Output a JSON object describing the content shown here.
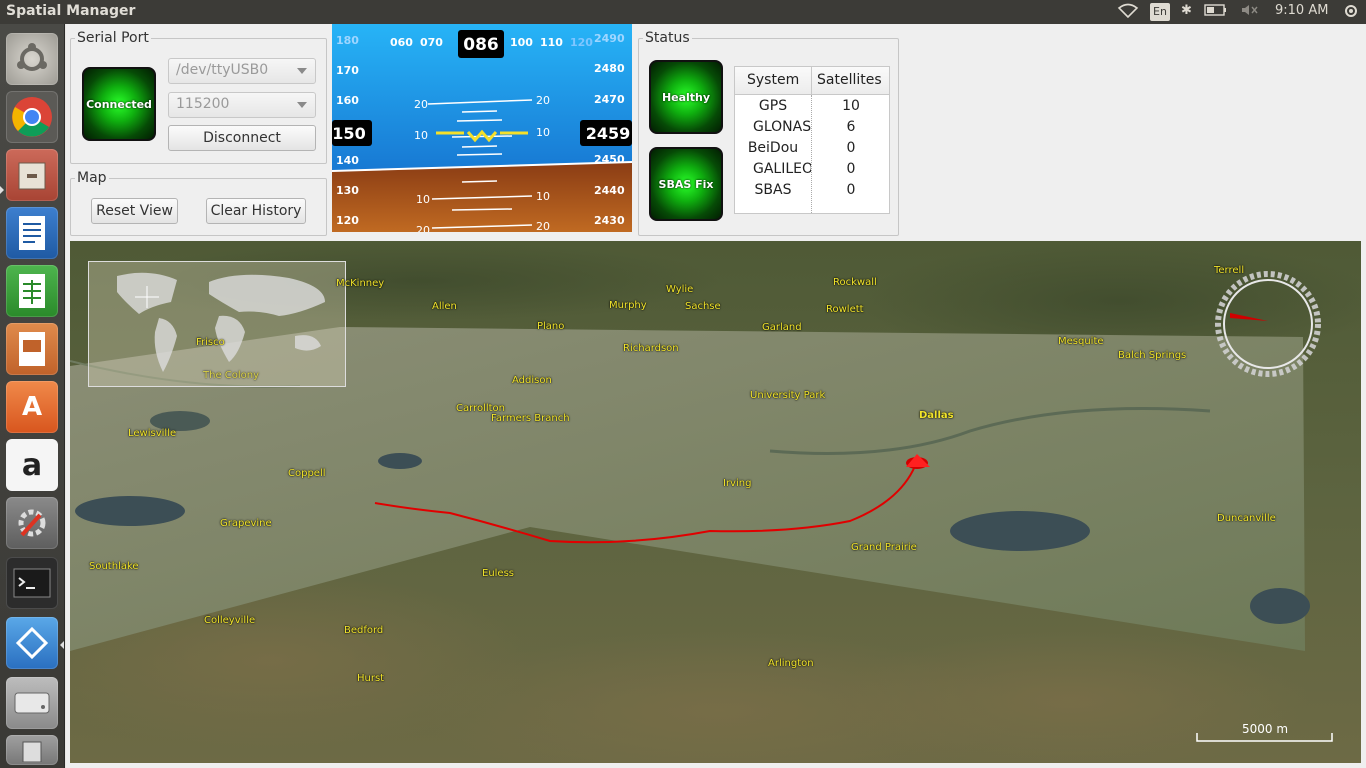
{
  "window": {
    "title": "Spatial Manager"
  },
  "panel": {
    "keyboard": "En",
    "time": "9:10 AM"
  },
  "launcher": {
    "items": [
      "ubuntu-dash",
      "chrome",
      "files",
      "writer",
      "calc",
      "impress",
      "software-center",
      "amazon",
      "system-settings",
      "terminal",
      "qt-creator",
      "disk",
      "trash"
    ]
  },
  "serial_port": {
    "title": "Serial Port",
    "status_led": "Connected",
    "device": "/dev/ttyUSB0",
    "baud": "115200",
    "disconnect_label": "Disconnect"
  },
  "map_controls": {
    "title": "Map",
    "reset_label": "Reset View",
    "clear_label": "Clear History"
  },
  "attitude": {
    "heading": "086",
    "heading_ticks": [
      "180",
      "060",
      "070",
      "100",
      "110",
      "120"
    ],
    "speed": "150",
    "speed_ticks": [
      "170",
      "160",
      "140",
      "130",
      "120"
    ],
    "altitude": "2459",
    "alt_ticks": [
      "2490",
      "2480",
      "2470",
      "2450",
      "2440",
      "2430"
    ],
    "pitch_labels": [
      "20",
      "10",
      "10",
      "20"
    ],
    "sky_color": "#2fa6f0",
    "ground_color": "#b5651d"
  },
  "status": {
    "title": "Status",
    "health_led": "Healthy",
    "sbas_led": "SBAS Fix",
    "table": {
      "headers": [
        "System",
        "Satellites"
      ],
      "rows": [
        {
          "system": "GPS",
          "count": "10"
        },
        {
          "system": "GLONASS",
          "count": "6"
        },
        {
          "system": "BeiDou",
          "count": "0"
        },
        {
          "system": "GALILEO",
          "count": "0"
        },
        {
          "system": "SBAS",
          "count": "0"
        }
      ]
    }
  },
  "map": {
    "track_color": "#e00000",
    "scale_label": "5000 m",
    "places": [
      "McKinney",
      "Allen",
      "Wylie",
      "Murphy",
      "Sachse",
      "Rockwall",
      "Rowlett",
      "Plano",
      "Garland",
      "Richardson",
      "Terrell",
      "Mesquite",
      "Balch Springs",
      "Frisco",
      "The Colony",
      "Addison",
      "University Park",
      "Carrollton",
      "Farmers Branch",
      "Dallas",
      "Lewisville",
      "Coppell",
      "Irving",
      "Grapevine",
      "Duncanville",
      "Grand Prairie",
      "Southlake",
      "Euless",
      "Colleyville",
      "Bedford",
      "Arlington",
      "Hurst"
    ]
  }
}
